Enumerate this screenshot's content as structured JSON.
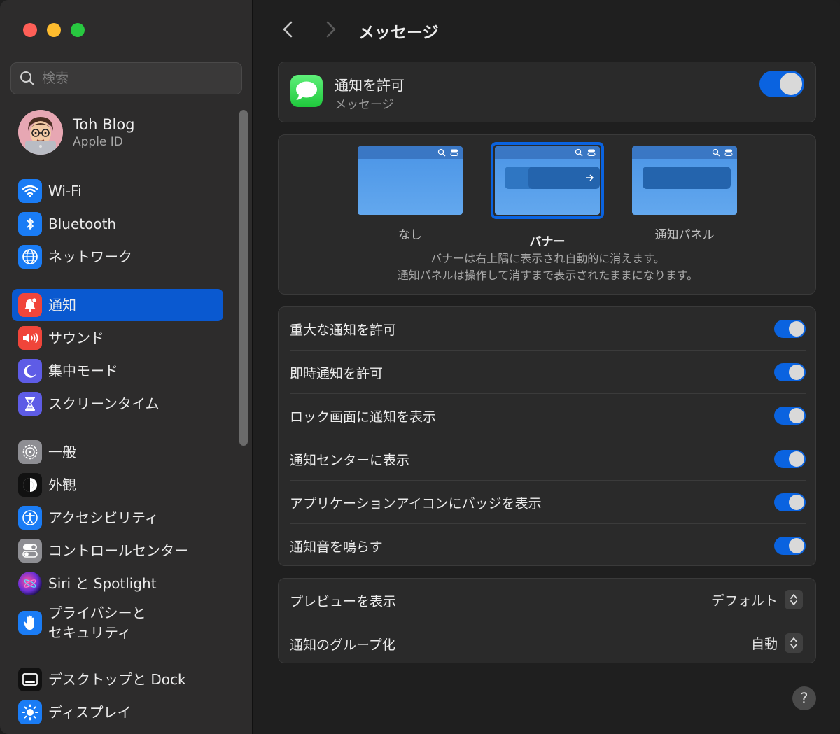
{
  "window": {
    "title": "メッセージ"
  },
  "search": {
    "placeholder": "検索"
  },
  "profile": {
    "name": "Toh Blog",
    "subtitle": "Apple ID"
  },
  "sidebar": {
    "items": [
      {
        "label": "Wi-Fi",
        "icon": "wifi-icon",
        "color": "#1a7cf5"
      },
      {
        "label": "Bluetooth",
        "icon": "bluetooth-icon",
        "color": "#1a7cf5"
      },
      {
        "label": "ネットワーク",
        "icon": "globe-icon",
        "color": "#1a7cf5"
      },
      {
        "label": "通知",
        "icon": "bell-icon",
        "color": "#f0453a",
        "selected": true
      },
      {
        "label": "サウンド",
        "icon": "speaker-icon",
        "color": "#f0453a"
      },
      {
        "label": "集中モード",
        "icon": "moon-icon",
        "color": "#5e5ce6"
      },
      {
        "label": "スクリーンタイム",
        "icon": "hourglass-icon",
        "color": "#5e5ce6"
      },
      {
        "label": "一般",
        "icon": "gear-icon",
        "color": "#8e8e93"
      },
      {
        "label": "外観",
        "icon": "appearance-icon",
        "color": "#1c1c1e"
      },
      {
        "label": "アクセシビリティ",
        "icon": "accessibility-icon",
        "color": "#1a7cf5"
      },
      {
        "label": "コントロールセンター",
        "icon": "control-center-icon",
        "color": "#8e8e93"
      },
      {
        "label": "Siri と Spotlight",
        "icon": "siri-icon",
        "color": "#8b3bd6"
      },
      {
        "label_line1": "プライバシーと",
        "label_line2": "セキュリティ",
        "icon": "hand-icon",
        "color": "#1a7cf5"
      },
      {
        "label": "デスクトップと Dock",
        "icon": "dock-icon",
        "color": "#1c1c1e"
      },
      {
        "label": "ディスプレイ",
        "icon": "sun-icon",
        "color": "#1a7cf5"
      }
    ]
  },
  "main": {
    "allow": {
      "title": "通知を許可",
      "subtitle": "メッセージ",
      "enabled": true
    },
    "styles": {
      "options": [
        {
          "label": "なし",
          "selected": false
        },
        {
          "label": "バナー",
          "selected": true
        },
        {
          "label": "通知パネル",
          "selected": false
        }
      ],
      "desc_line1": "バナーは右上隅に表示され自動的に消えます。",
      "desc_line2": "通知パネルは操作して消すまで表示されたままになります。"
    },
    "options": [
      {
        "label": "重大な通知を許可",
        "enabled": true
      },
      {
        "label": "即時通知を許可",
        "enabled": true
      },
      {
        "label": "ロック画面に通知を表示",
        "enabled": true
      },
      {
        "label": "通知センターに表示",
        "enabled": true
      },
      {
        "label": "アプリケーションアイコンにバッジを表示",
        "enabled": true
      },
      {
        "label": "通知音を鳴らす",
        "enabled": true
      }
    ],
    "preview": {
      "label": "プレビューを表示",
      "value": "デフォルト"
    },
    "grouping": {
      "label": "通知のグループ化",
      "value": "自動"
    },
    "help_label": "?"
  },
  "colors": {
    "accent": "#0a63e0",
    "selected_bg": "#0a59d0"
  }
}
